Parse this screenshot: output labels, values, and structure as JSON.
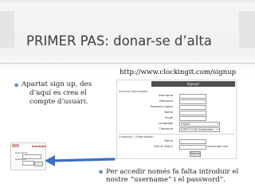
{
  "slide": {
    "title": "PRIMER PAS: donar-se d’alta",
    "url": "http://www.clockingit.com/signup",
    "bullet1": {
      "line1": "Apartat sign up, des",
      "line2": "d’aquí es crea el",
      "line3": "compte d’usuari."
    },
    "bullet2": {
      "line1": "Per accedir només fa falta introduir el",
      "line2": "nostre “username” i el password”."
    },
    "bullet_glyph": "▪"
  },
  "signup_form": {
    "header": "Signup!",
    "section_account": "Account Information",
    "fields": {
      "username": "Username",
      "password": "Password",
      "password_again": "Password Again",
      "name": "Name",
      "email": "Email",
      "language": "Language",
      "timezone": "Timezone"
    },
    "language_value": "English",
    "timezone_value": "(GMT+01:00) Amsterdam",
    "section_company": "Company / Organization",
    "company_name": "Name",
    "site_label": "Site at http://",
    "site_suffix": ".clockingit.com",
    "signup_button": "Signup"
  },
  "login_thumb": {
    "title": "ipsalalal",
    "username_label": "Username",
    "password_label": "Password"
  },
  "colors": {
    "accent_bullet": "#5a8ac6",
    "arrow": "#3a6fc4",
    "signup_header_bg": "#4f4f4f"
  }
}
